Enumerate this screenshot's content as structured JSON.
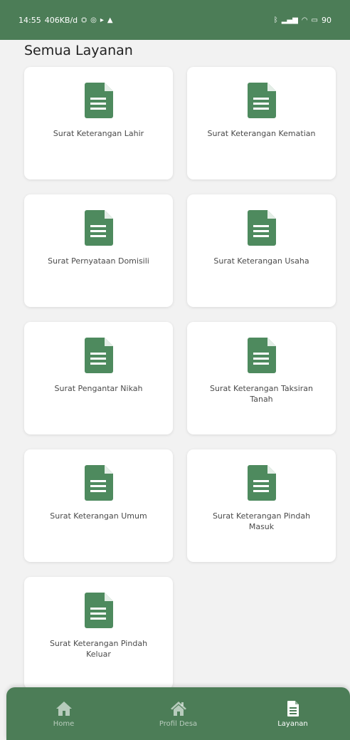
{
  "status_bar": {
    "time": "14:55",
    "speed": "406KB/d",
    "battery": "90"
  },
  "page_title": "Semua Layanan",
  "services": [
    {
      "label": "Surat Keterangan Lahir"
    },
    {
      "label": "Surat Keterangan Kematian"
    },
    {
      "label": "Surat Pernyataan Domisili"
    },
    {
      "label": "Surat Keterangan Usaha"
    },
    {
      "label": "Surat Pengantar Nikah"
    },
    {
      "label": "Surat Keterangan Taksiran Tanah"
    },
    {
      "label": "Surat Keterangan Umum"
    },
    {
      "label": "Surat Keterangan Pindah Masuk"
    },
    {
      "label": "Surat Keterangan Pindah Keluar"
    }
  ],
  "bottom_nav": {
    "items": [
      {
        "label": "Home",
        "icon": "home-icon"
      },
      {
        "label": "Profil Desa",
        "icon": "village-home-icon"
      },
      {
        "label": "Layanan",
        "icon": "document-icon",
        "active": true
      }
    ]
  },
  "colors": {
    "primary": "#4c7d57",
    "icon": "#4e8a5e",
    "background": "#f2f2f2",
    "card": "#ffffff"
  }
}
